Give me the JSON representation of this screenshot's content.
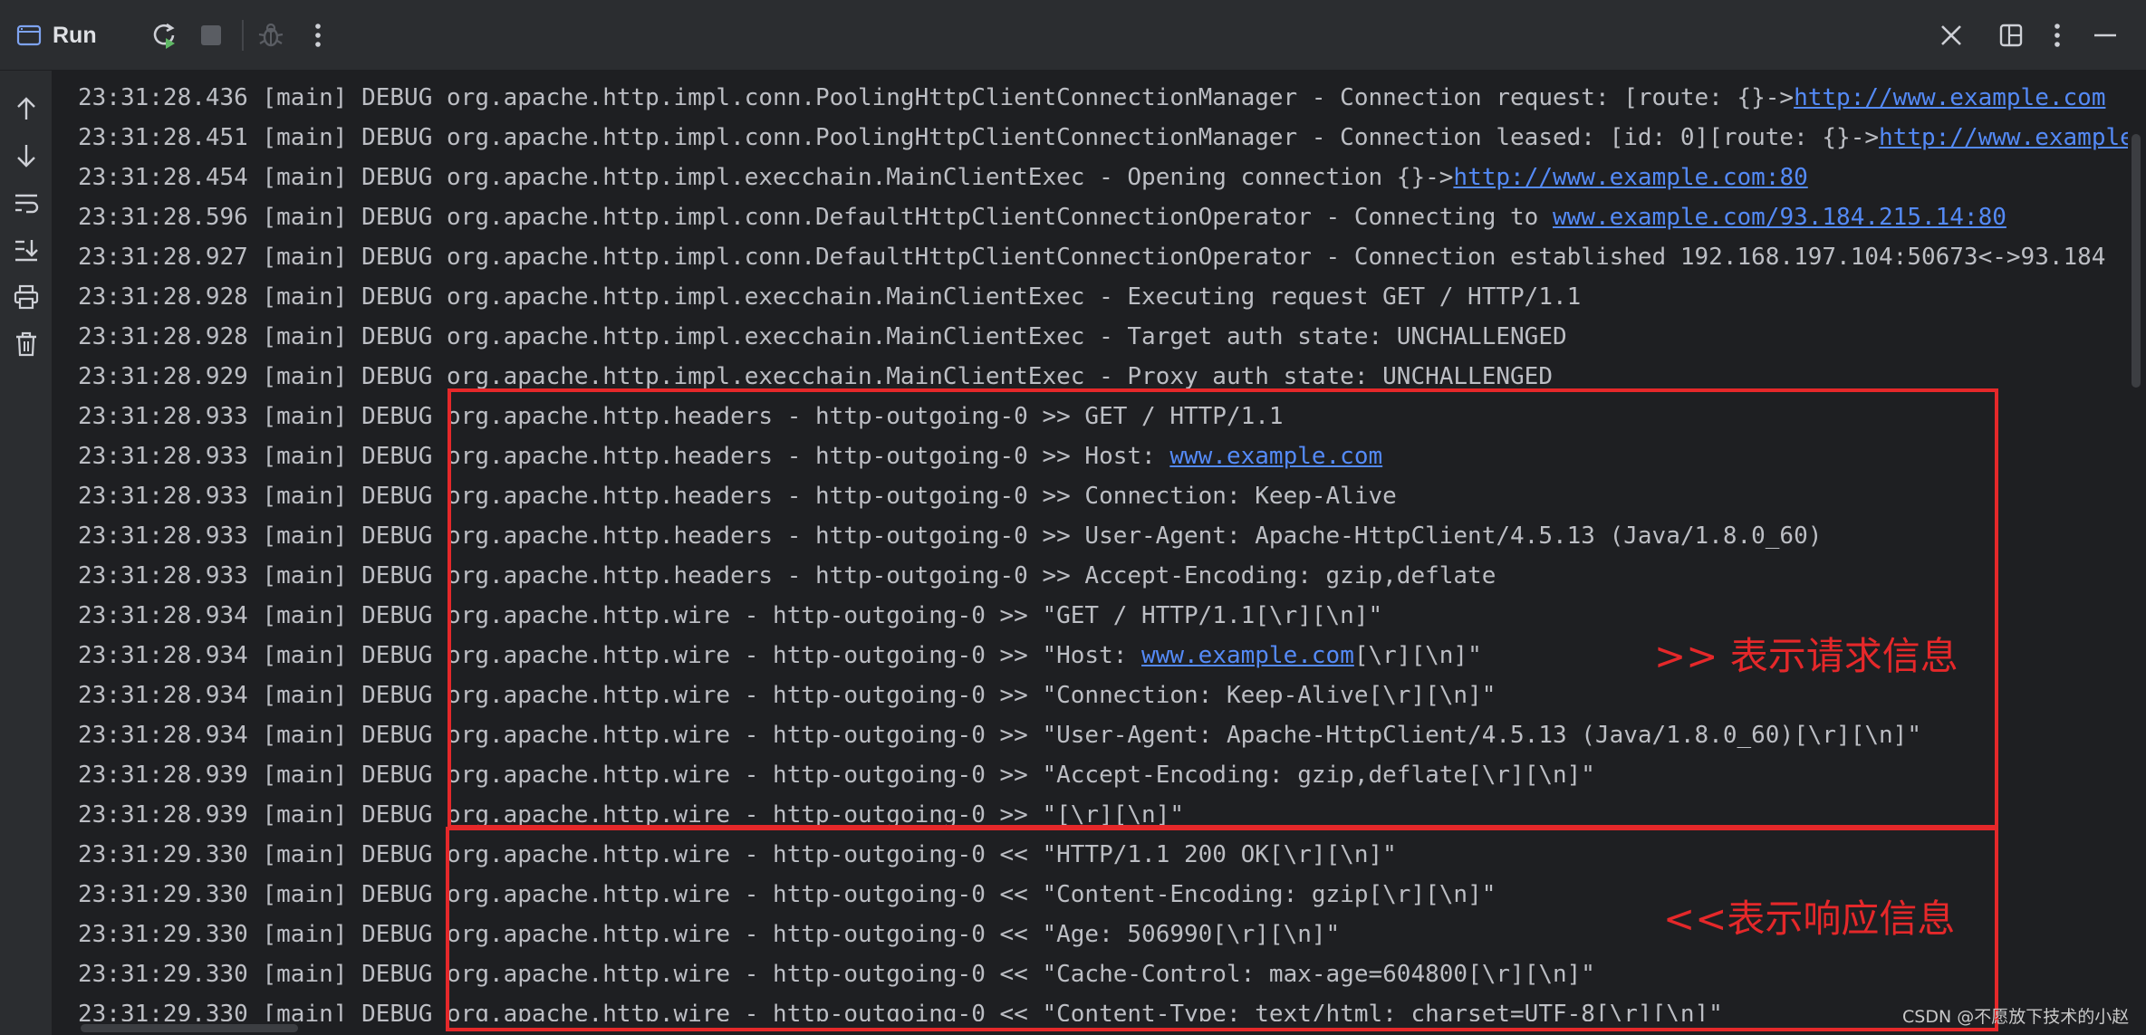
{
  "toolbar": {
    "run_label": "Run",
    "icons": [
      "console-window-icon",
      "rerun-icon",
      "stop-icon",
      "debug-icon",
      "more-vertical-icon",
      "close-icon",
      "layout-icon",
      "more-vertical-icon",
      "minimize-icon"
    ]
  },
  "sidebar": {
    "icons": [
      "arrow-up-icon",
      "arrow-down-icon",
      "soft-wrap-icon",
      "scroll-to-end-icon",
      "print-icon",
      "trash-icon"
    ]
  },
  "console": {
    "lines": [
      {
        "ts": "23:31:28.436",
        "thread": "[main]",
        "level": "DEBUG",
        "logger": "org.apache.http.impl.conn.PoolingHttpClientConnectionManager",
        "msg": " - Connection request: [route: {}->",
        "link": "http://www.example.com",
        "after": ""
      },
      {
        "ts": "23:31:28.451",
        "thread": "[main]",
        "level": "DEBUG",
        "logger": "org.apache.http.impl.conn.PoolingHttpClientConnectionManager",
        "msg": " - Connection leased: [id: 0][route: {}->",
        "link": "http://www.example",
        "after": ""
      },
      {
        "ts": "23:31:28.454",
        "thread": "[main]",
        "level": "DEBUG",
        "logger": "org.apache.http.impl.execchain.MainClientExec",
        "msg": " - Opening connection {}->",
        "link": "http://www.example.com:80",
        "after": ""
      },
      {
        "ts": "23:31:28.596",
        "thread": "[main]",
        "level": "DEBUG",
        "logger": "org.apache.http.impl.conn.DefaultHttpClientConnectionOperator",
        "msg": " - Connecting to ",
        "link": "www.example.com/93.184.215.14:80",
        "after": ""
      },
      {
        "ts": "23:31:28.927",
        "thread": "[main]",
        "level": "DEBUG",
        "logger": "org.apache.http.impl.conn.DefaultHttpClientConnectionOperator",
        "msg": " - Connection established 192.168.197.104:50673<->93.184",
        "link": "",
        "after": ""
      },
      {
        "ts": "23:31:28.928",
        "thread": "[main]",
        "level": "DEBUG",
        "logger": "org.apache.http.impl.execchain.MainClientExec",
        "msg": " - Executing request GET / HTTP/1.1",
        "link": "",
        "after": ""
      },
      {
        "ts": "23:31:28.928",
        "thread": "[main]",
        "level": "DEBUG",
        "logger": "org.apache.http.impl.execchain.MainClientExec",
        "msg": " - Target auth state: UNCHALLENGED",
        "link": "",
        "after": ""
      },
      {
        "ts": "23:31:28.929",
        "thread": "[main]",
        "level": "DEBUG",
        "logger": "org.apache.http.impl.execchain.MainClientExec",
        "msg": " - Proxy auth state: UNCHALLENGED",
        "link": "",
        "after": ""
      },
      {
        "ts": "23:31:28.933",
        "thread": "[main]",
        "level": "DEBUG",
        "logger": "org.apache.http.headers",
        "msg": " - http-outgoing-0 >> GET / HTTP/1.1",
        "link": "",
        "after": ""
      },
      {
        "ts": "23:31:28.933",
        "thread": "[main]",
        "level": "DEBUG",
        "logger": "org.apache.http.headers",
        "msg": " - http-outgoing-0 >> Host: ",
        "link": "www.example.com",
        "after": ""
      },
      {
        "ts": "23:31:28.933",
        "thread": "[main]",
        "level": "DEBUG",
        "logger": "org.apache.http.headers",
        "msg": " - http-outgoing-0 >> Connection: Keep-Alive",
        "link": "",
        "after": ""
      },
      {
        "ts": "23:31:28.933",
        "thread": "[main]",
        "level": "DEBUG",
        "logger": "org.apache.http.headers",
        "msg": " - http-outgoing-0 >> User-Agent: Apache-HttpClient/4.5.13 (Java/1.8.0_60)",
        "link": "",
        "after": ""
      },
      {
        "ts": "23:31:28.933",
        "thread": "[main]",
        "level": "DEBUG",
        "logger": "org.apache.http.headers",
        "msg": " - http-outgoing-0 >> Accept-Encoding: gzip,deflate",
        "link": "",
        "after": ""
      },
      {
        "ts": "23:31:28.934",
        "thread": "[main]",
        "level": "DEBUG",
        "logger": "org.apache.http.wire",
        "msg": " - http-outgoing-0 >> \"GET / HTTP/1.1[\\r][\\n]\"",
        "link": "",
        "after": ""
      },
      {
        "ts": "23:31:28.934",
        "thread": "[main]",
        "level": "DEBUG",
        "logger": "org.apache.http.wire",
        "msg": " - http-outgoing-0 >> \"Host: ",
        "link": "www.example.com",
        "after": "[\\r][\\n]\""
      },
      {
        "ts": "23:31:28.934",
        "thread": "[main]",
        "level": "DEBUG",
        "logger": "org.apache.http.wire",
        "msg": " - http-outgoing-0 >> \"Connection: Keep-Alive[\\r][\\n]\"",
        "link": "",
        "after": ""
      },
      {
        "ts": "23:31:28.934",
        "thread": "[main]",
        "level": "DEBUG",
        "logger": "org.apache.http.wire",
        "msg": " - http-outgoing-0 >> \"User-Agent: Apache-HttpClient/4.5.13 (Java/1.8.0_60)[\\r][\\n]\"",
        "link": "",
        "after": ""
      },
      {
        "ts": "23:31:28.939",
        "thread": "[main]",
        "level": "DEBUG",
        "logger": "org.apache.http.wire",
        "msg": " - http-outgoing-0 >> \"Accept-Encoding: gzip,deflate[\\r][\\n]\"",
        "link": "",
        "after": ""
      },
      {
        "ts": "23:31:28.939",
        "thread": "[main]",
        "level": "DEBUG",
        "logger": "org.apache.http.wire",
        "msg": " - http-outgoing-0 >> \"[\\r][\\n]\"",
        "link": "",
        "after": ""
      },
      {
        "ts": "23:31:29.330",
        "thread": "[main]",
        "level": "DEBUG",
        "logger": "org.apache.http.wire",
        "msg": " - http-outgoing-0 << \"HTTP/1.1 200 OK[\\r][\\n]\"",
        "link": "",
        "after": ""
      },
      {
        "ts": "23:31:29.330",
        "thread": "[main]",
        "level": "DEBUG",
        "logger": "org.apache.http.wire",
        "msg": " - http-outgoing-0 << \"Content-Encoding: gzip[\\r][\\n]\"",
        "link": "",
        "after": ""
      },
      {
        "ts": "23:31:29.330",
        "thread": "[main]",
        "level": "DEBUG",
        "logger": "org.apache.http.wire",
        "msg": " - http-outgoing-0 << \"Age: 506990[\\r][\\n]\"",
        "link": "",
        "after": ""
      },
      {
        "ts": "23:31:29.330",
        "thread": "[main]",
        "level": "DEBUG",
        "logger": "org.apache.http.wire",
        "msg": " - http-outgoing-0 << \"Cache-Control: max-age=604800[\\r][\\n]\"",
        "link": "",
        "after": ""
      },
      {
        "ts": "23:31:29.330",
        "thread": "[main]",
        "level": "DEBUG",
        "logger": "org.apache.http.wire",
        "msg": " - http-outgoing-0 << \"Content-Type: text/html; charset=UTF-8[\\r][\\n]\"",
        "link": "",
        "after": ""
      }
    ]
  },
  "annotations": {
    "request_label": ">> 表示请求信息",
    "response_label": "<<表示响应信息"
  },
  "watermark": "CSDN @不愿放下技术的小赵",
  "colors": {
    "background": "#1e1f22",
    "toolbar": "#2b2d30",
    "log_text": "#bcbec4",
    "link": "#548af7",
    "annotation_red": "#e5282a"
  }
}
